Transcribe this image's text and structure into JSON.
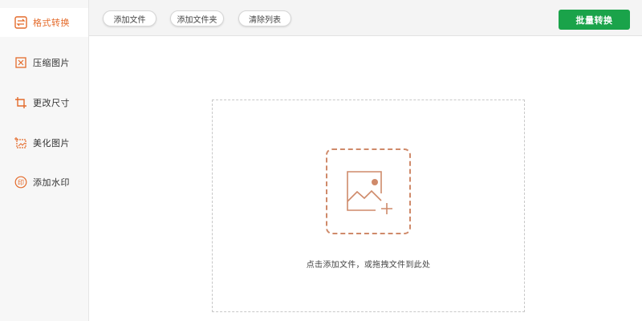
{
  "sidebar": {
    "items": [
      {
        "label": "格式转换",
        "icon": "convert-icon",
        "active": true
      },
      {
        "label": "压缩图片",
        "icon": "compress-icon",
        "active": false
      },
      {
        "label": "更改尺寸",
        "icon": "crop-icon",
        "active": false
      },
      {
        "label": "美化图片",
        "icon": "beautify-icon",
        "active": false
      },
      {
        "label": "添加水印",
        "icon": "watermark-icon",
        "active": false
      }
    ]
  },
  "toolbar": {
    "add_file_label": "添加文件",
    "add_folder_label": "添加文件夹",
    "clear_list_label": "清除列表",
    "batch_convert_label": "批量转换"
  },
  "dropzone": {
    "icon": "add-image-icon",
    "hint": "点击添加文件，或拖拽文件到此处"
  },
  "colors": {
    "accent": "#e46b2b",
    "primary_button": "#1aa34a",
    "dropzone_icon": "#cf8a6a"
  }
}
